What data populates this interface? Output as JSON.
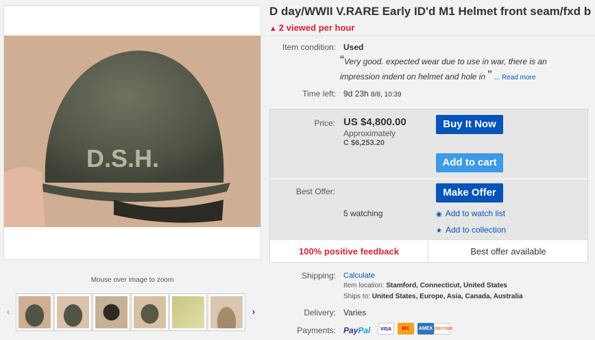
{
  "title": "D day/WWII V.RARE Early ID'd M1 Helmet front seam/fxd b",
  "viewed": "2 viewed per hour",
  "condition": {
    "label": "Item condition:",
    "value": "Used",
    "description": "Very good. expected wear due to use in war, there is an impression indent on helmet and hole in",
    "read_more": "... Read more"
  },
  "time_left": {
    "label": "Time left:",
    "value": "9d 23h",
    "date": "8/8, 10:39"
  },
  "price": {
    "label": "Price:",
    "value": "US $4,800.00",
    "approx_label": "Approximately",
    "approx_value": "C $6,253.20"
  },
  "buttons": {
    "buy_now": "Buy It Now",
    "add_to_cart": "Add to cart",
    "make_offer": "Make Offer"
  },
  "best_offer": {
    "label": "Best Offer:",
    "watching": "5 watching",
    "watch_link": "Add to watch list",
    "collection_link": "Add to collection"
  },
  "feedback": {
    "left": "100% positive feedback",
    "right": "Best offer available"
  },
  "shipping": {
    "label": "Shipping:",
    "value": "Calculate",
    "location_label": "Item location:",
    "location": "Stamford, Connecticut, United States",
    "ships_label": "Ships to:",
    "ships_to": "United States, Europe, Asia, Canada, Australia"
  },
  "delivery": {
    "label": "Delivery:",
    "value": "Varies"
  },
  "payments": {
    "label": "Payments:",
    "paypal_a": "Pay",
    "paypal_b": "Pal",
    "cards": [
      "VISA",
      "MC",
      "AMEX",
      "DISCOVER"
    ]
  },
  "image": {
    "zoom_hint": "Mouse over image to zoom",
    "helmet_text": "D.S.H."
  },
  "colors": {
    "link": "#0654ba",
    "alert": "#dd1e31",
    "button_dark": "#0654ba",
    "button_light": "#3c9ae6"
  }
}
